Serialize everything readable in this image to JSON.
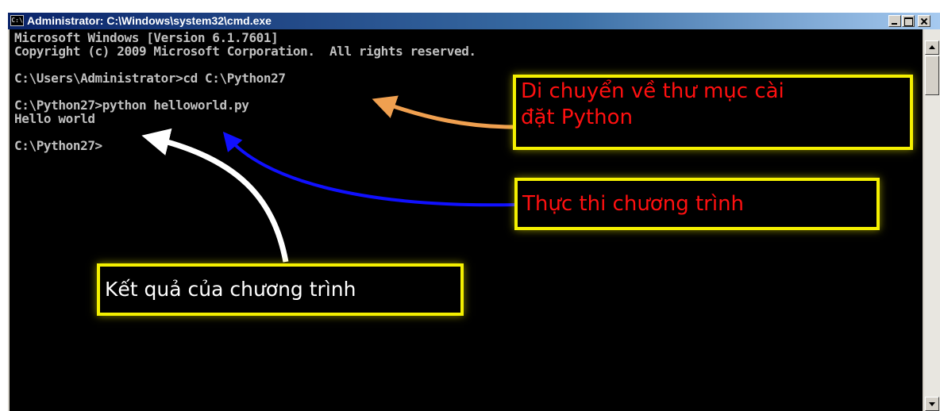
{
  "window": {
    "title": "Administrator: C:\\Windows\\system32\\cmd.exe",
    "icon": "cmd-icon",
    "icon_text": "C:\\"
  },
  "console": {
    "lines": [
      "Microsoft Windows [Version 6.1.7601]",
      "Copyright (c) 2009 Microsoft Corporation.  All rights reserved.",
      "",
      "C:\\Users\\Administrator>cd C:\\Python27",
      "",
      "C:\\Python27>python helloworld.py",
      "Hello world",
      "",
      "C:\\Python27>"
    ]
  },
  "annotations": {
    "move_dir": {
      "line1": "Di chuyển về thư mục cài",
      "line2": "đặt Python"
    },
    "run_program": "Thực thi chương trình",
    "program_result": "Kết quả của chương trình"
  },
  "colors": {
    "callout_border": "#f4f000",
    "callout_red_text": "#ff1010",
    "arrow_orange": "#f0a050",
    "arrow_blue": "#1010ff",
    "arrow_white": "#ffffff",
    "console_bg": "#000000",
    "console_text": "#c0c0c0"
  }
}
